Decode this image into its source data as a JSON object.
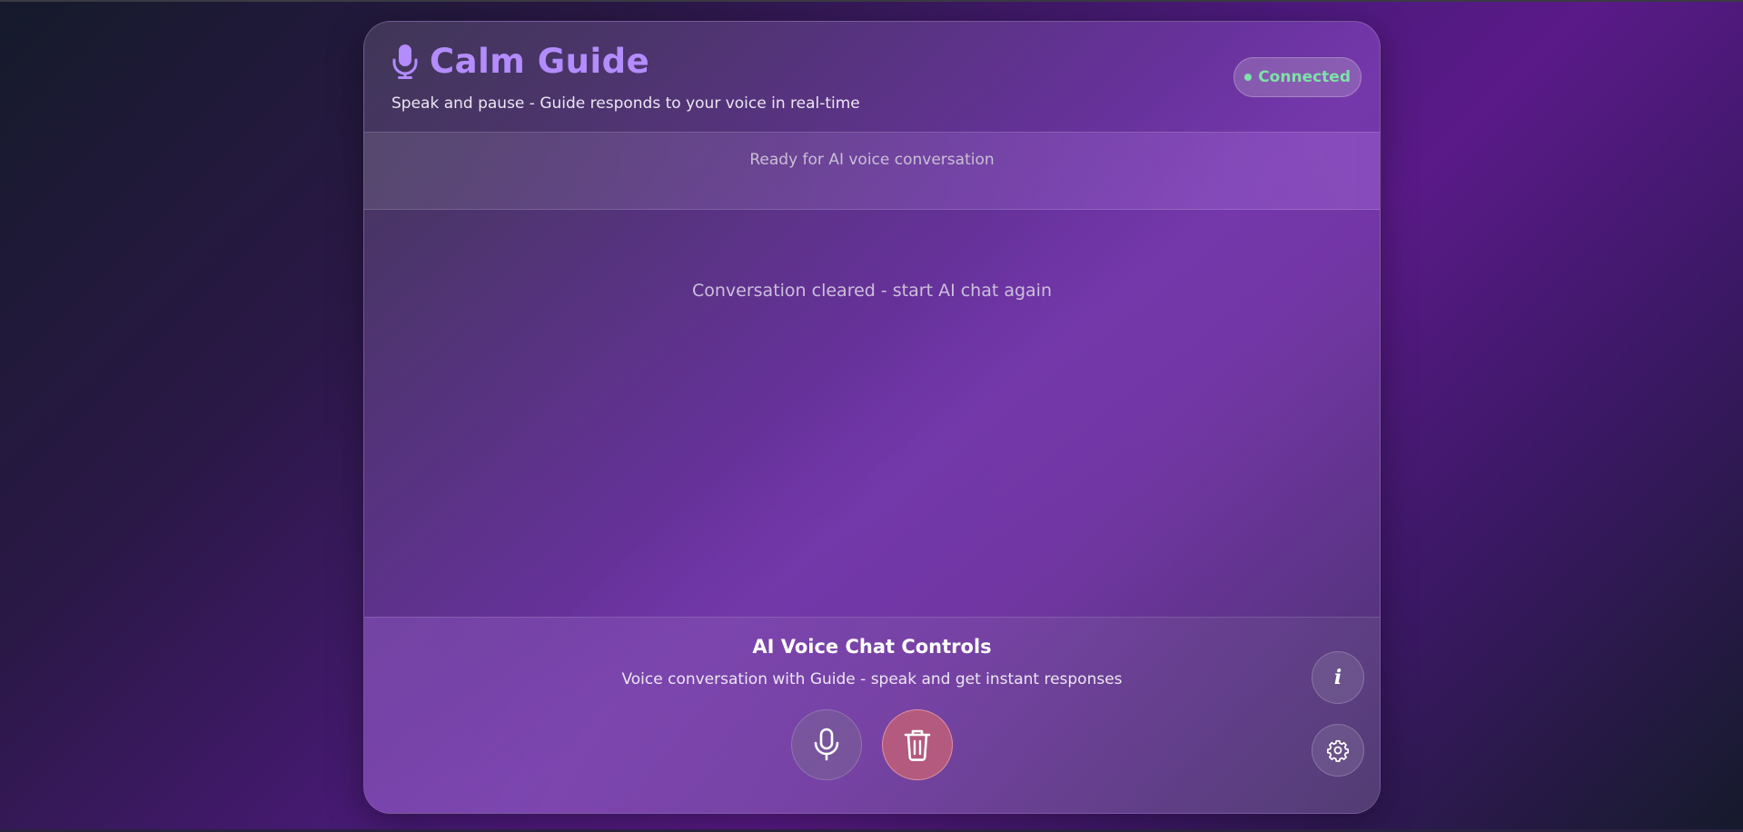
{
  "app": {
    "title": "Calm Guide",
    "subtitle": "Speak and pause - Guide responds to your voice in real-time",
    "title_icon": "microphone-icon"
  },
  "connection": {
    "status_label": "Connected",
    "status_color": "#7ee2a8"
  },
  "status_bar": {
    "text": "Ready for AI voice conversation"
  },
  "conversation": {
    "message": "Conversation cleared - start AI chat again"
  },
  "controls": {
    "title": "AI Voice Chat Controls",
    "description": "Voice conversation with Guide - speak and get instant responses",
    "buttons": [
      {
        "name": "mic-button",
        "icon": "microphone-icon"
      },
      {
        "name": "clear-button",
        "icon": "trash-icon",
        "color": "#b35a7e"
      }
    ],
    "side_buttons": [
      {
        "name": "info-button",
        "icon": "info-icon",
        "label": "i"
      },
      {
        "name": "settings-button",
        "icon": "gear-icon"
      }
    ]
  },
  "colors": {
    "accent": "#b38cff",
    "danger": "#b35a7e"
  }
}
